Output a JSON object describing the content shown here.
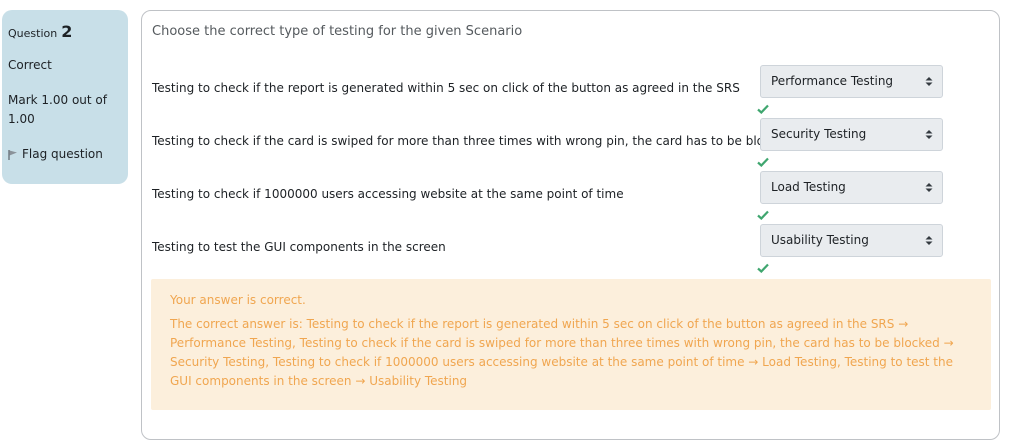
{
  "info": {
    "question_label": "Question",
    "question_number": "2",
    "state": "Correct",
    "grade": "Mark 1.00 out of 1.00",
    "flag_label": "Flag question"
  },
  "question": {
    "prompt": "Choose the correct type of testing for the given Scenario",
    "rows": [
      {
        "text": "Testing to check if the report is generated within 5 sec on click of the button as agreed in the SRS",
        "selected": "Performance Testing"
      },
      {
        "text": "Testing to check if the card is swiped for more than three times with wrong pin, the card has to be blocked",
        "selected": "Security Testing"
      },
      {
        "text": "Testing to check if 1000000 users accessing website at the same point of time",
        "selected": "Load Testing"
      },
      {
        "text": "Testing to test the GUI components in the screen",
        "selected": "Usability Testing"
      }
    ]
  },
  "feedback": {
    "title": "Your answer is correct.",
    "answer": "The correct answer is: Testing to check if the report is generated within 5 sec on click of the button as agreed in the SRS → Performance Testing, Testing to check if the card is swiped for more than three times with wrong pin, the card has to be blocked → Security Testing, Testing to check if 1000000 users accessing website at the same point of time → Load Testing, Testing to test the GUI components in the screen → Usability Testing"
  },
  "colors": {
    "info_bg": "#c8dfe8",
    "check": "#3fa66f",
    "feedback_bg": "#fcefdc",
    "feedback_text": "#f0a650"
  },
  "icons": {
    "flag": "flag-icon",
    "select_arrows": "sort-arrows-icon",
    "correct": "check-icon"
  }
}
